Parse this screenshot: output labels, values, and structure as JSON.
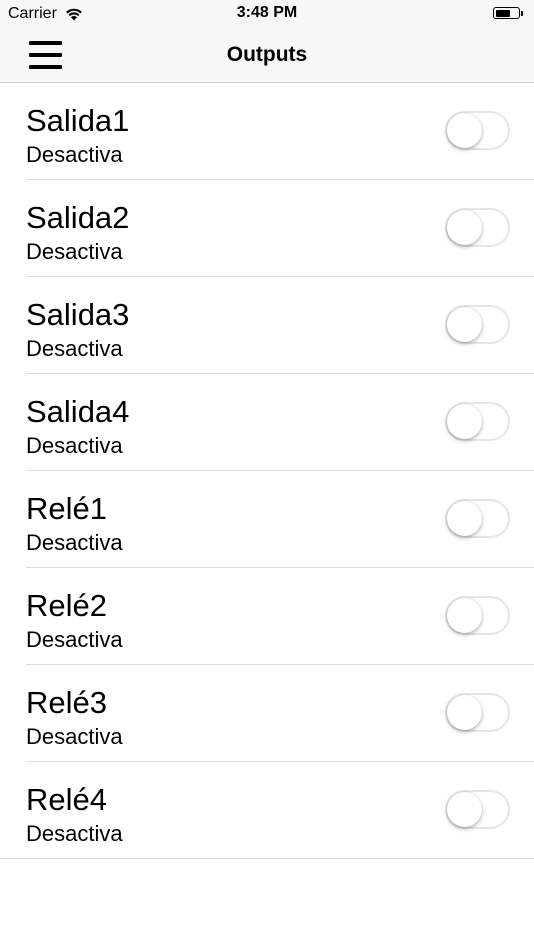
{
  "status_bar": {
    "carrier": "Carrier",
    "time": "3:48 PM",
    "wifi_icon": "wifi-icon",
    "battery_icon": "battery-icon",
    "battery_level": 0.65
  },
  "nav": {
    "title": "Outputs",
    "menu_icon": "hamburger-menu-icon"
  },
  "outputs": [
    {
      "name": "Salida1",
      "status": "Desactiva",
      "enabled": false
    },
    {
      "name": "Salida2",
      "status": "Desactiva",
      "enabled": false
    },
    {
      "name": "Salida3",
      "status": "Desactiva",
      "enabled": false
    },
    {
      "name": "Salida4",
      "status": "Desactiva",
      "enabled": false
    },
    {
      "name": "Relé1",
      "status": "Desactiva",
      "enabled": false
    },
    {
      "name": "Relé2",
      "status": "Desactiva",
      "enabled": false
    },
    {
      "name": "Relé3",
      "status": "Desactiva",
      "enabled": false
    },
    {
      "name": "Relé4",
      "status": "Desactiva",
      "enabled": false
    }
  ],
  "colors": {
    "bar_background": "#f7f7f7",
    "toggle_off_border": "#e6e6e6",
    "separator": "#dcdcdc"
  }
}
